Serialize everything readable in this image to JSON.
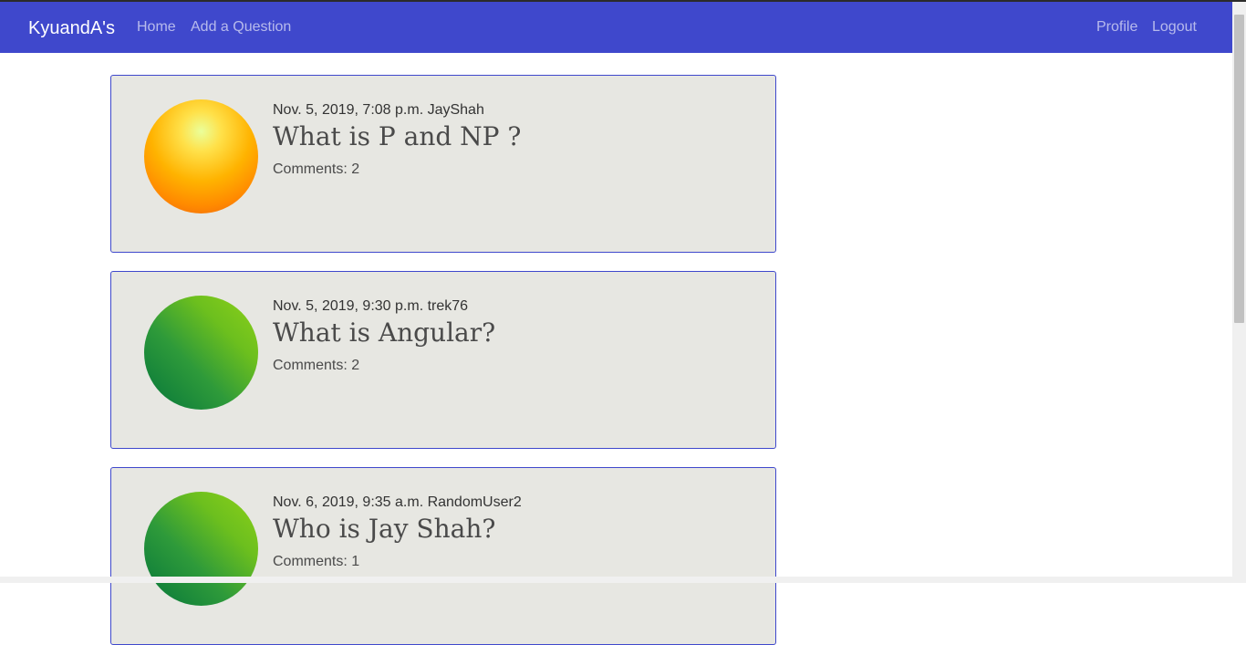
{
  "navbar": {
    "brand": "KyuandA's",
    "home_label": "Home",
    "add_question_label": "Add a Question",
    "profile_label": "Profile",
    "logout_label": "Logout"
  },
  "colors": {
    "navbar": "#3f48cc",
    "card_background": "#e7e7e2",
    "card_border": "#3f48cc"
  },
  "questions": [
    {
      "meta": "Nov. 5, 2019, 7:08 p.m. JayShah",
      "title": "What is P and NP ?",
      "comments": "Comments: 2",
      "avatar": "orange-sun-avatar"
    },
    {
      "meta": "Nov. 5, 2019, 9:30 p.m. trek76",
      "title": "What is Angular?",
      "comments": "Comments: 2",
      "avatar": "green-leaf-avatar"
    },
    {
      "meta": "Nov. 6, 2019, 9:35 a.m. RandomUser2",
      "title": "Who is Jay Shah?",
      "comments": "Comments: 1",
      "avatar": "green-leaf-avatar"
    }
  ]
}
